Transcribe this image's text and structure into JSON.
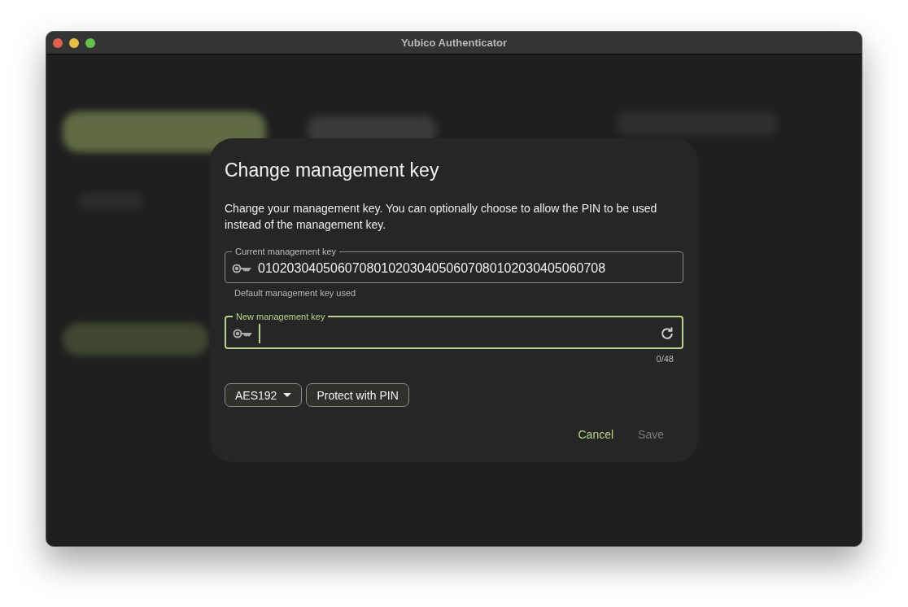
{
  "window": {
    "title": "Yubico Authenticator"
  },
  "dialog": {
    "title": "Change management key",
    "description": "Change your management key. You can optionally choose to allow the PIN to be used instead of the management key.",
    "fields": [
      {
        "label": "Current management key",
        "value": "010203040506070801020304050607080102030405060708",
        "helper": "Default management key used",
        "focused": false,
        "has_refresh": false
      },
      {
        "label": "New management key",
        "counter": "0/48",
        "focused": true,
        "has_refresh": true
      }
    ],
    "key_type": "AES192",
    "pin_chip": "Protect with PIN",
    "actions": [
      {
        "label": "Cancel",
        "disabled": false
      },
      {
        "label": "Save",
        "disabled": true
      }
    ]
  }
}
